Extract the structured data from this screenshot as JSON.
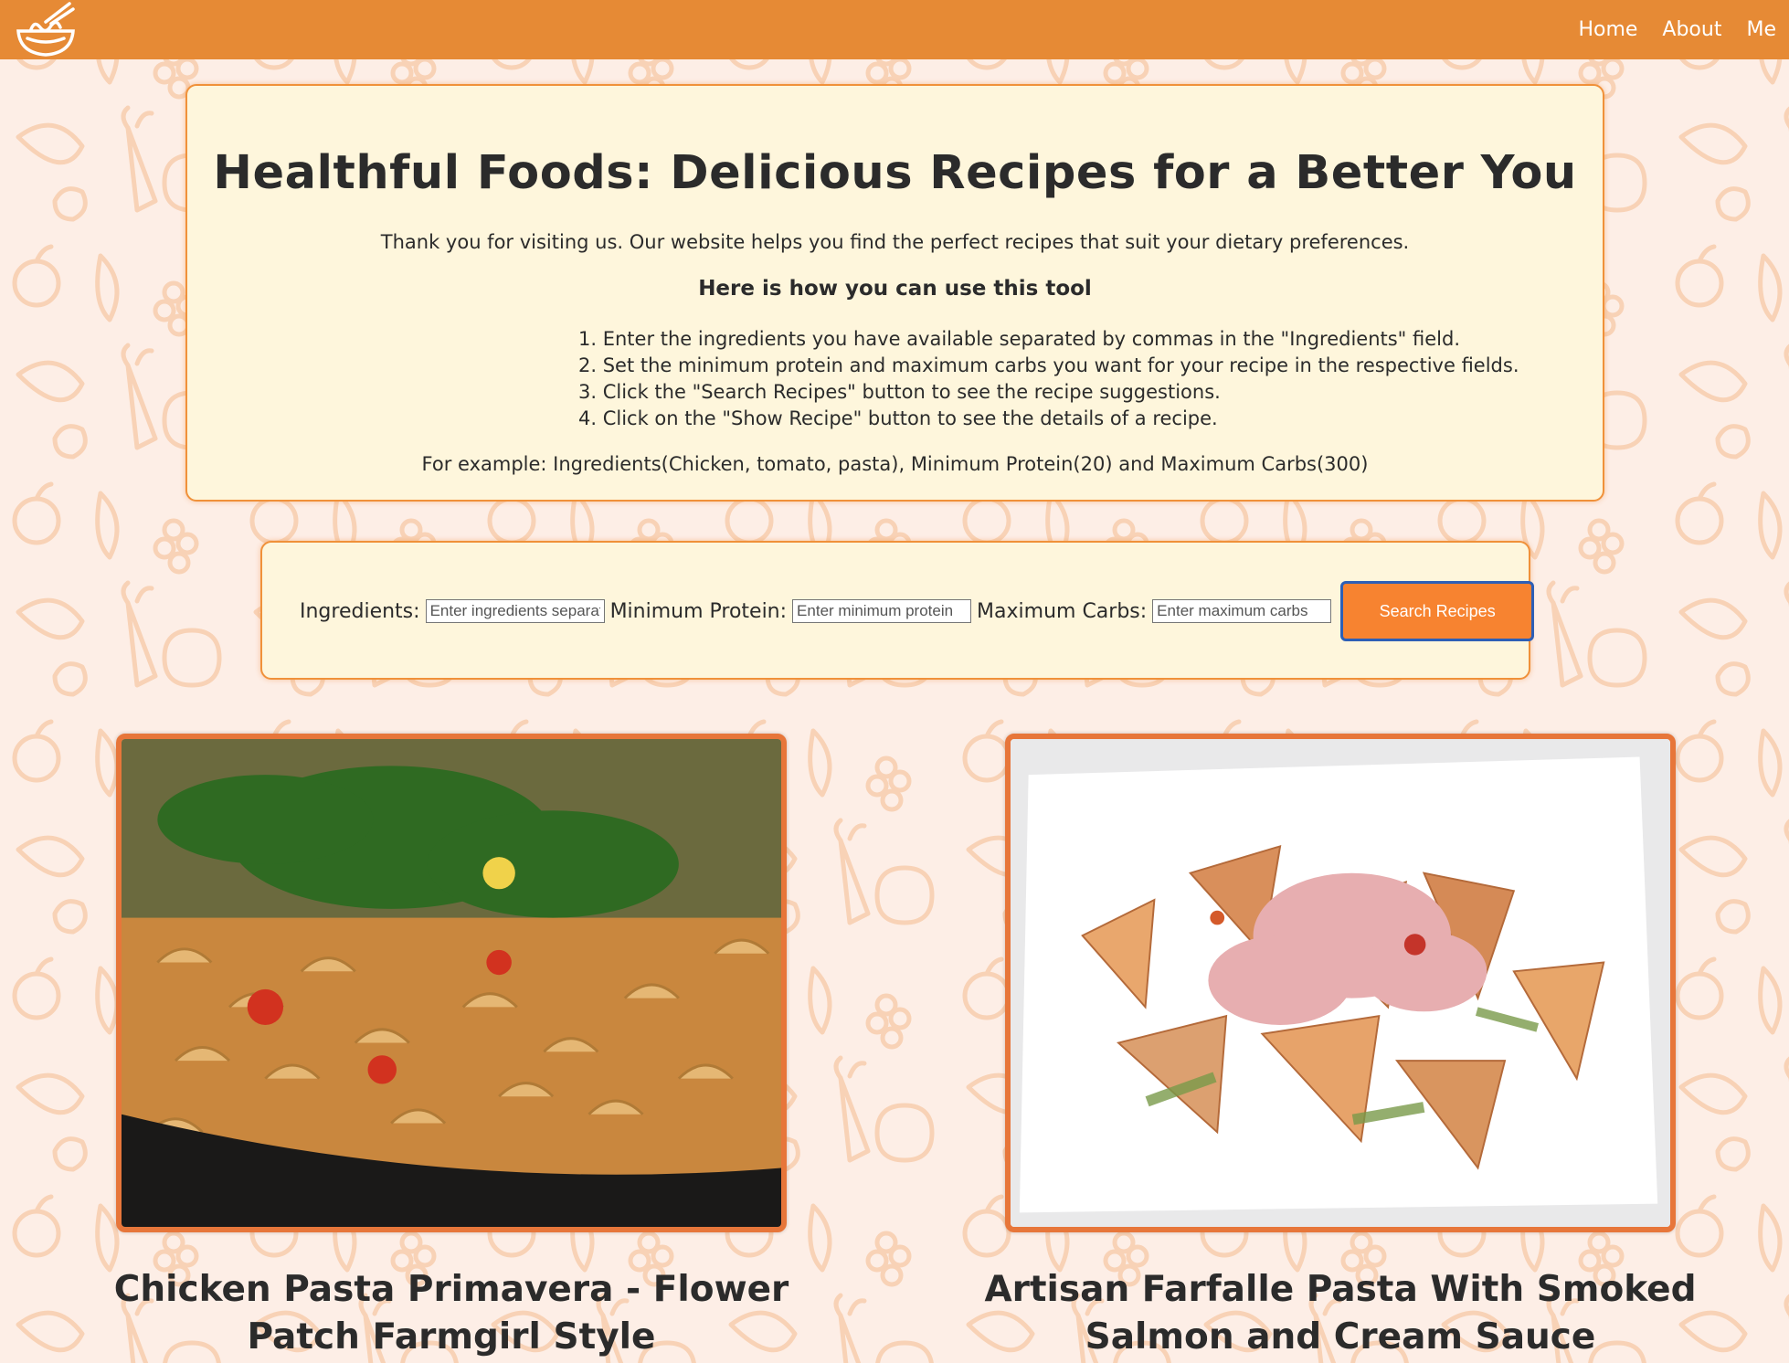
{
  "colors": {
    "navbar": "#e68a35",
    "card_background": "#fef6dc",
    "card_border": "#f0913a",
    "button": "#f78330",
    "page_background": "#fdeee6"
  },
  "nav": {
    "logo_icon": "noodle-bowl-icon",
    "links": [
      "Home",
      "About",
      "Me"
    ]
  },
  "intro": {
    "title": "Healthful Foods: Delicious Recipes for a Better You",
    "description": "Thank you for visiting us. Our website helps you find the perfect recipes that suit your dietary preferences.",
    "howto_heading": "Here is how you can use this tool",
    "steps": [
      "1. Enter the ingredients you have available separated by commas in the \"Ingredients\" field.",
      "2. Set the minimum protein and maximum carbs you want for your recipe in the respective fields.",
      "3. Click the \"Search Recipes\" button to see the recipe suggestions.",
      "4. Click on the \"Show Recipe\" button to see the details of a recipe."
    ],
    "example": "For example: Ingredients(Chicken, tomato, pasta), Minimum Protein(20) and Maximum Carbs(300)"
  },
  "search": {
    "ingredients_label": "Ingredients:",
    "ingredients_placeholder": "Enter ingredients separated by commas",
    "protein_label": "Minimum Protein:",
    "protein_placeholder": "Enter minimum protein",
    "carbs_label": "Maximum Carbs:",
    "carbs_placeholder": "Enter maximum carbs",
    "button_label": "Search Recipes"
  },
  "recipes": [
    {
      "title": "Chicken Pasta Primavera - Flower Patch Farmgirl Style"
    },
    {
      "title": "Artisan Farfalle Pasta With Smoked Salmon and Cream Sauce"
    }
  ]
}
